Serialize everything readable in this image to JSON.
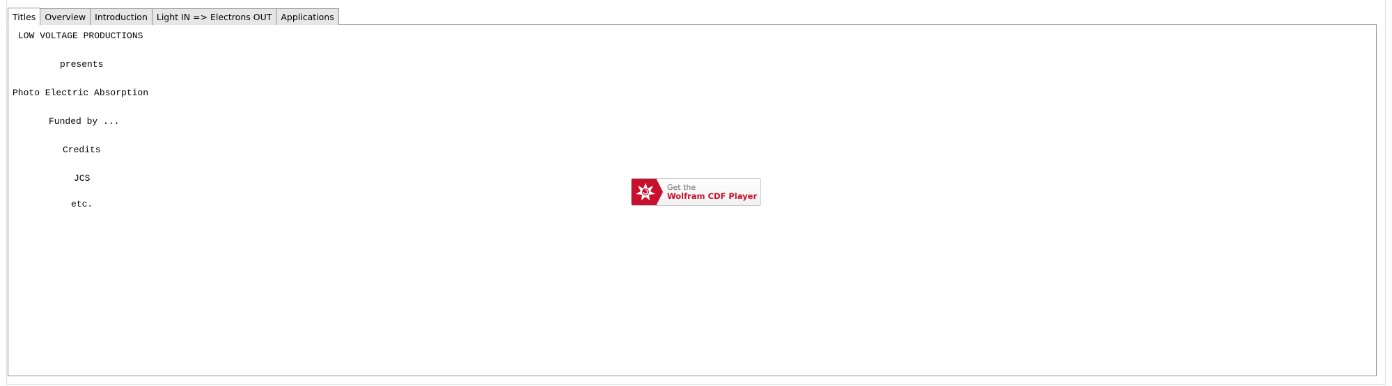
{
  "tabs": [
    {
      "label": "Titles",
      "active": true
    },
    {
      "label": "Overview",
      "active": false
    },
    {
      "label": "Introduction",
      "active": false
    },
    {
      "label": "Light IN => Electrons OUT",
      "active": false
    },
    {
      "label": "Applications",
      "active": false
    }
  ],
  "titles": {
    "producer": "LOW VOLTAGE PRODUCTIONS",
    "presents": "presents",
    "title": "Photo Electric Absorption",
    "funded": "Funded by ...",
    "credits": "Credits",
    "author": "JCS",
    "etc": "etc."
  },
  "cdf_player": {
    "get_text": "Get the",
    "name_text": "Wolfram CDF Player",
    "icon": "wolfram-spikey-icon",
    "brand_color": "#c8102e"
  }
}
